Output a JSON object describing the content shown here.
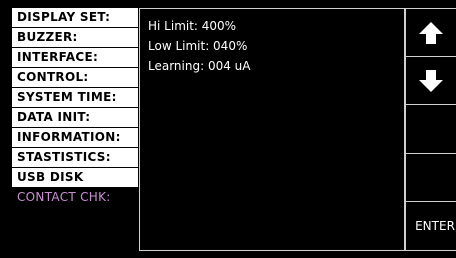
{
  "menu": {
    "items": [
      {
        "label": "DISPLAY SET:"
      },
      {
        "label": "BUZZER:"
      },
      {
        "label": "INTERFACE:"
      },
      {
        "label": "CONTROL:"
      },
      {
        "label": "SYSTEM TIME:"
      },
      {
        "label": "DATA INIT:"
      },
      {
        "label": "INFORMATION:"
      },
      {
        "label": "STASTISTICS:"
      },
      {
        "label": "USB DISK"
      },
      {
        "label": "CONTACT CHK:"
      }
    ],
    "selected_index": 9
  },
  "params": {
    "hi_limit": "Hi Limit: 400%",
    "low_limit": "Low Limit: 040%",
    "learning": "Learning: 004 uA"
  },
  "softkeys": {
    "up_icon": "up-arrow-icon",
    "down_icon": "down-arrow-icon",
    "enter_label": "ENTER"
  },
  "colors": {
    "background": "#000000",
    "menu_item_bg": "#ffffff",
    "selected_text": "#c98fd0",
    "border": "#d0d0d0"
  }
}
